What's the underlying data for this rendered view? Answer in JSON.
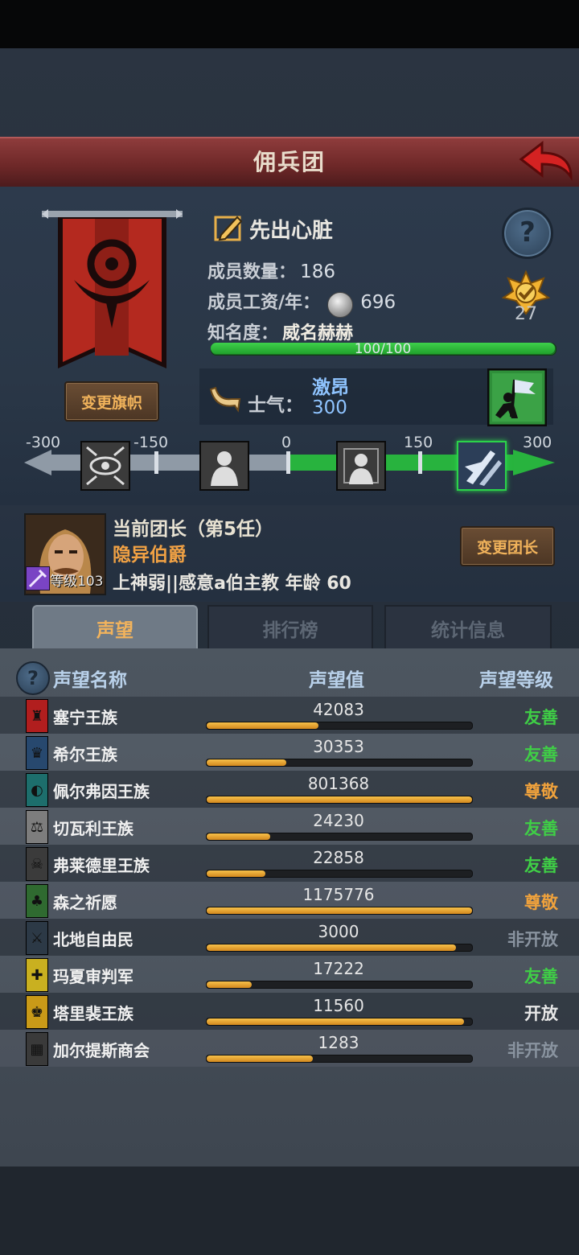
{
  "header": {
    "title": "佣兵团"
  },
  "guild": {
    "name": "先出心脏",
    "members_label": "成员数量：",
    "members_value": "186",
    "wage_label": "成员工资/年：",
    "wage_value": "696",
    "fame_label": "知名度：",
    "fame_value": "威名赫赫",
    "fame_progress_text": "100/100",
    "fame_progress": 1.0,
    "medal_count": "27",
    "change_flag_label": "变更旗帜"
  },
  "morale": {
    "label": "士气：",
    "state": "激昂",
    "value": "300",
    "scale_labels": [
      "-300",
      "-150",
      "0",
      "150",
      "300"
    ]
  },
  "leader": {
    "title": "当前团长（第5任）",
    "name": "隐异伯爵",
    "level": "等级103",
    "info": "上神弱||感意a伯主教  年龄  60",
    "change_label": "变更团长"
  },
  "tabs": [
    {
      "label": "声望"
    },
    {
      "label": "排行榜"
    },
    {
      "label": "统计信息"
    }
  ],
  "table": {
    "headers": [
      "声望名称",
      "声望值",
      "声望等级"
    ],
    "rows": [
      {
        "name": "塞宁王族",
        "value": "42083",
        "fill": 0.42,
        "level": "友善",
        "level_color": "#3fcf46",
        "icon_bg": "#b11e1e",
        "icon_glyph": "♜"
      },
      {
        "name": "希尔王族",
        "value": "30353",
        "fill": 0.3,
        "level": "友善",
        "level_color": "#3fcf46",
        "icon_bg": "#27486e",
        "icon_glyph": "♛"
      },
      {
        "name": "佩尔弗因王族",
        "value": "801368",
        "fill": 1.0,
        "level": "尊敬",
        "level_color": "#f0a23c",
        "icon_bg": "#1d6e6c",
        "icon_glyph": "◐"
      },
      {
        "name": "切瓦利王族",
        "value": "24230",
        "fill": 0.24,
        "level": "友善",
        "level_color": "#3fcf46",
        "icon_bg": "#7d7d7d",
        "icon_glyph": "⚖"
      },
      {
        "name": "弗莱德里王族",
        "value": "22858",
        "fill": 0.22,
        "level": "友善",
        "level_color": "#3fcf46",
        "icon_bg": "#3b3b3b",
        "icon_glyph": "☠"
      },
      {
        "name": "森之祈愿",
        "value": "1175776",
        "fill": 1.0,
        "level": "尊敬",
        "level_color": "#f0a23c",
        "icon_bg": "#2f6a30",
        "icon_glyph": "♣"
      },
      {
        "name": "北地自由民",
        "value": "3000",
        "fill": 0.94,
        "level": "非开放",
        "level_color": "#8a94a0",
        "icon_bg": "#2c3946",
        "icon_glyph": "⚔"
      },
      {
        "name": "玛夏审判军",
        "value": "17222",
        "fill": 0.17,
        "level": "友善",
        "level_color": "#3fcf46",
        "icon_bg": "#c9b020",
        "icon_glyph": "✚"
      },
      {
        "name": "塔里裴王族",
        "value": "11560",
        "fill": 0.97,
        "level": "开放",
        "level_color": "#e8e8e8",
        "icon_bg": "#c99a18",
        "icon_glyph": "♚"
      },
      {
        "name": "加尔提斯商会",
        "value": "1283",
        "fill": 0.4,
        "level": "非开放",
        "level_color": "#8a94a0",
        "icon_bg": "#3a3a3a",
        "icon_glyph": "▦"
      }
    ]
  },
  "colors": {
    "accent": "#f0a144",
    "positive": "#3fcf46",
    "morale": "#8fc4ff"
  }
}
